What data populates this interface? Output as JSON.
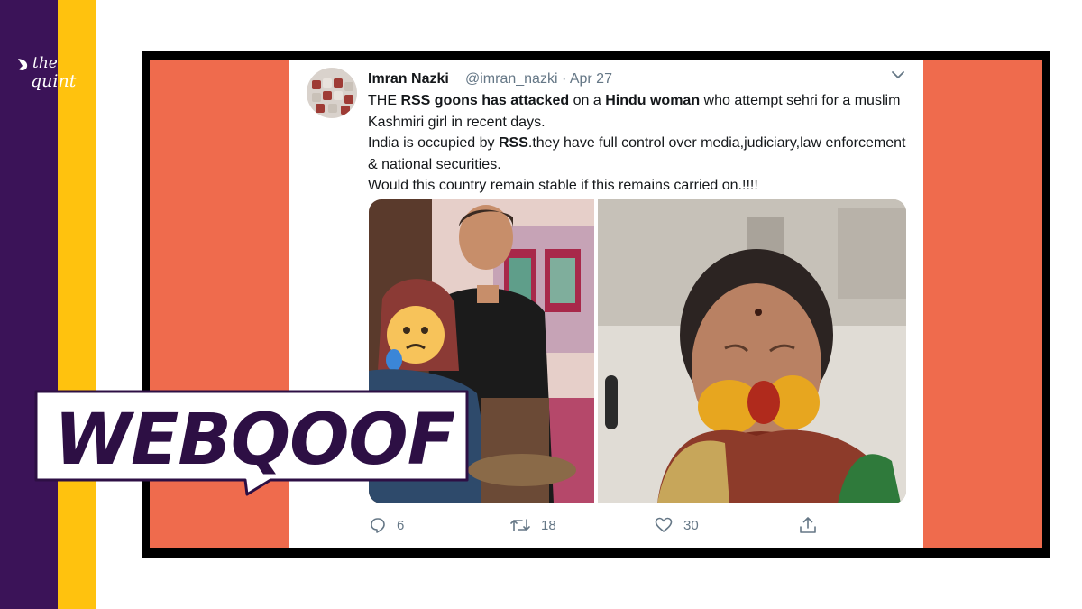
{
  "brand": {
    "logo_text_1": "the",
    "logo_text_2": "quint",
    "colors": {
      "purple": "#3b1358",
      "yellow": "#ffc20e",
      "coral": "#ef6b4d"
    }
  },
  "tweet": {
    "author_name": "Imran Nazki",
    "author_handle": "@imran_nazki · Apr 27",
    "lines": [
      {
        "parts": [
          {
            "t": "THE ",
            "b": false
          },
          {
            "t": "RSS goons has attacked",
            "b": true
          },
          {
            "t": " on a ",
            "b": false
          },
          {
            "t": "Hindu woman",
            "b": true
          },
          {
            "t": " who attempt sehri  for a muslim Kashmiri girl in recent days.",
            "b": false
          }
        ]
      },
      {
        "parts": [
          {
            "t": "India is occupied by ",
            "b": false
          },
          {
            "t": "RSS",
            "b": true
          },
          {
            "t": ".they have full control over media,judiciary,law enforcement & national securities.",
            "b": false
          }
        ]
      },
      {
        "parts": [
          {
            "t": "Would this country remain stable if this remains carried on.!!!!",
            "b": false
          }
        ]
      }
    ],
    "actions": {
      "replies": "6",
      "retweets": "18",
      "likes": "30"
    },
    "icons": [
      "chevron-down-icon",
      "reply-icon",
      "retweet-icon",
      "like-icon",
      "share-icon"
    ]
  },
  "badge": {
    "label": "WEBQOOF"
  }
}
